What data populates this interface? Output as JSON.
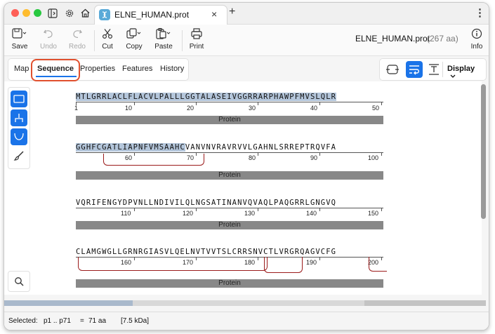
{
  "window": {
    "tab_title": "ELNE_HUMAN.prot",
    "new_tab_label": "+",
    "close_tab_label": "×",
    "more_label": "⋮"
  },
  "toolbar": {
    "save": "Save",
    "undo": "Undo",
    "redo": "Redo",
    "cut": "Cut",
    "copy": "Copy",
    "paste": "Paste",
    "print": "Print",
    "info": "Info",
    "doc_name": "ELNE_HUMAN.prot",
    "doc_length": "(267 aa)"
  },
  "view_tabs": [
    "Map",
    "Sequence",
    "Properties",
    "Features",
    "History"
  ],
  "active_view": "Sequence",
  "display_label": "Display",
  "sequence_rows": [
    {
      "pre": "",
      "highlighted": "MTLGRRLACLFLACVLPALLLGGTALASEIVGGRRARPHAWPFMVSLQLR",
      "post": "",
      "numbers": [
        "1",
        "10",
        "20",
        "30",
        "40",
        "50"
      ],
      "feature": "Protein"
    },
    {
      "pre": "",
      "highlighted": "GGHFCGATLIAPNFVMSAAHC",
      "post": "VANVNVRAVRVVLGAHNLSRREPTRQVFA",
      "numbers": [
        "60",
        "70",
        "80",
        "90",
        "100"
      ],
      "feature": "Protein"
    },
    {
      "pre": "",
      "highlighted": "",
      "post": "VQRIFENGYDPVNLLNDIVILQLNGSATINANVQVAQLPAQGRRLGNGVQ",
      "numbers": [
        "110",
        "120",
        "130",
        "140",
        "150"
      ],
      "feature": "Protein"
    },
    {
      "pre": "",
      "highlighted": "",
      "post": "CLAMGWGLLGRNRGIASVLQELNVTVVTSLCRRSNVCTLVRGRQAGVCFG",
      "numbers": [
        "160",
        "170",
        "180",
        "190",
        "200"
      ],
      "feature": "Protein"
    }
  ],
  "status": {
    "selected_label": "Selected:",
    "range": "p1 .. p71",
    "equals": "=",
    "count": "71 aa",
    "mass": "[7.5 kDa]"
  },
  "colors": {
    "selection": "#b4c6db",
    "accent": "#1a73e8",
    "disulfide": "#9b1b1b",
    "annotation": "#e0502e"
  },
  "icons": [
    "sidebar-icon",
    "gear-icon",
    "home-icon",
    "save-icon",
    "undo-icon",
    "redo-icon",
    "scissors-icon",
    "copy-icon",
    "paste-icon",
    "printer-icon",
    "info-icon",
    "search-icon",
    "brush-icon"
  ]
}
